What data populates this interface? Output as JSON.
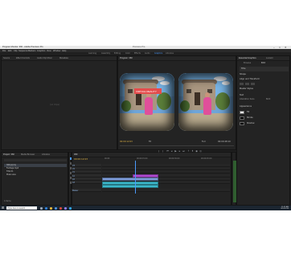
{
  "window": {
    "title": "Program Monitor: 360 - Adobe Premiere Pro",
    "center_caption": "Premiere Pro",
    "controls": [
      "–",
      "□",
      "✕"
    ]
  },
  "menu": [
    "File",
    "Edit",
    "Clip",
    "Sequence",
    "Markers",
    "Graphics",
    "View",
    "Window",
    "Help"
  ],
  "workspace_tabs": [
    "Learning",
    "Assembly",
    "Editing",
    "Color",
    "Effects",
    "Audio",
    "Graphics",
    "Libraries"
  ],
  "source_panel": {
    "tabs": [
      "Source",
      "Effect Controls",
      "Audio Clip Mixer",
      "Metadata"
    ],
    "empty_text": "(no clips)"
  },
  "program_monitor": {
    "tab": "Program: 360",
    "title_overlay_text": "VIRTUAL REALITY",
    "timecode_left": "00:00:12:03",
    "fit": "Fit",
    "quality": "Full",
    "timecode_right": "00:00:48:10"
  },
  "essential_graphics": {
    "tabs": [
      "Essential Graphics",
      "Lumetri"
    ],
    "sub_tabs": [
      "Browse",
      "Edit"
    ],
    "items": [
      "Title",
      "Shape",
      "Align and Transform",
      "Master Styles",
      "Text",
      "Appearance"
    ],
    "font": "Liberation Sans",
    "font_style": "Bold",
    "fill_label": "Fill",
    "stroke_label": "Stroke",
    "shadow_label": "Shadow",
    "colors": {
      "fill": "#ffffff",
      "stroke": "#000000",
      "shadow": "#000000"
    }
  },
  "project_panel": {
    "tabs": [
      "Project: 360",
      "Media Browser",
      "Libraries"
    ],
    "items": [
      "360.prproj",
      "Footage.mp4",
      "Title 01",
      "Music.wav"
    ],
    "footer": "4 Items"
  },
  "timeline": {
    "tab": "360",
    "timecode": "00:00:12:03",
    "ruler": [
      "00:00",
      "00:00:15:00",
      "00:00:30:00",
      "00:00:45:00"
    ],
    "tracks": [
      "V3",
      "V2",
      "V1",
      "A1",
      "A2",
      "A3",
      "Master"
    ],
    "clips": [
      {
        "track": "V2",
        "label": "Title 01",
        "color": "#b04ad0"
      },
      {
        "track": "V1",
        "label": "Footage.mp4",
        "color": "#7c9ad6"
      },
      {
        "track": "A1",
        "label": "Footage.mp4",
        "color": "#3bb7c9"
      },
      {
        "track": "A2",
        "label": "Music.wav",
        "color": "#3bb7c9"
      }
    ]
  },
  "taskbar": {
    "search_placeholder": "Type here to search",
    "time": "11:42 AM",
    "date": "3/14/2018",
    "apps": [
      {
        "name": "task-view-icon",
        "color": "#9aa7b5"
      },
      {
        "name": "edge-icon",
        "color": "#2f7fd6"
      },
      {
        "name": "explorer-icon",
        "color": "#e6b33a"
      },
      {
        "name": "store-icon",
        "color": "#4a8fd8"
      },
      {
        "name": "chrome-icon",
        "color": "#d9473b"
      },
      {
        "name": "premiere-icon",
        "color": "#8f7bf0"
      },
      {
        "name": "photoshop-icon",
        "color": "#2fa3e6"
      }
    ]
  }
}
